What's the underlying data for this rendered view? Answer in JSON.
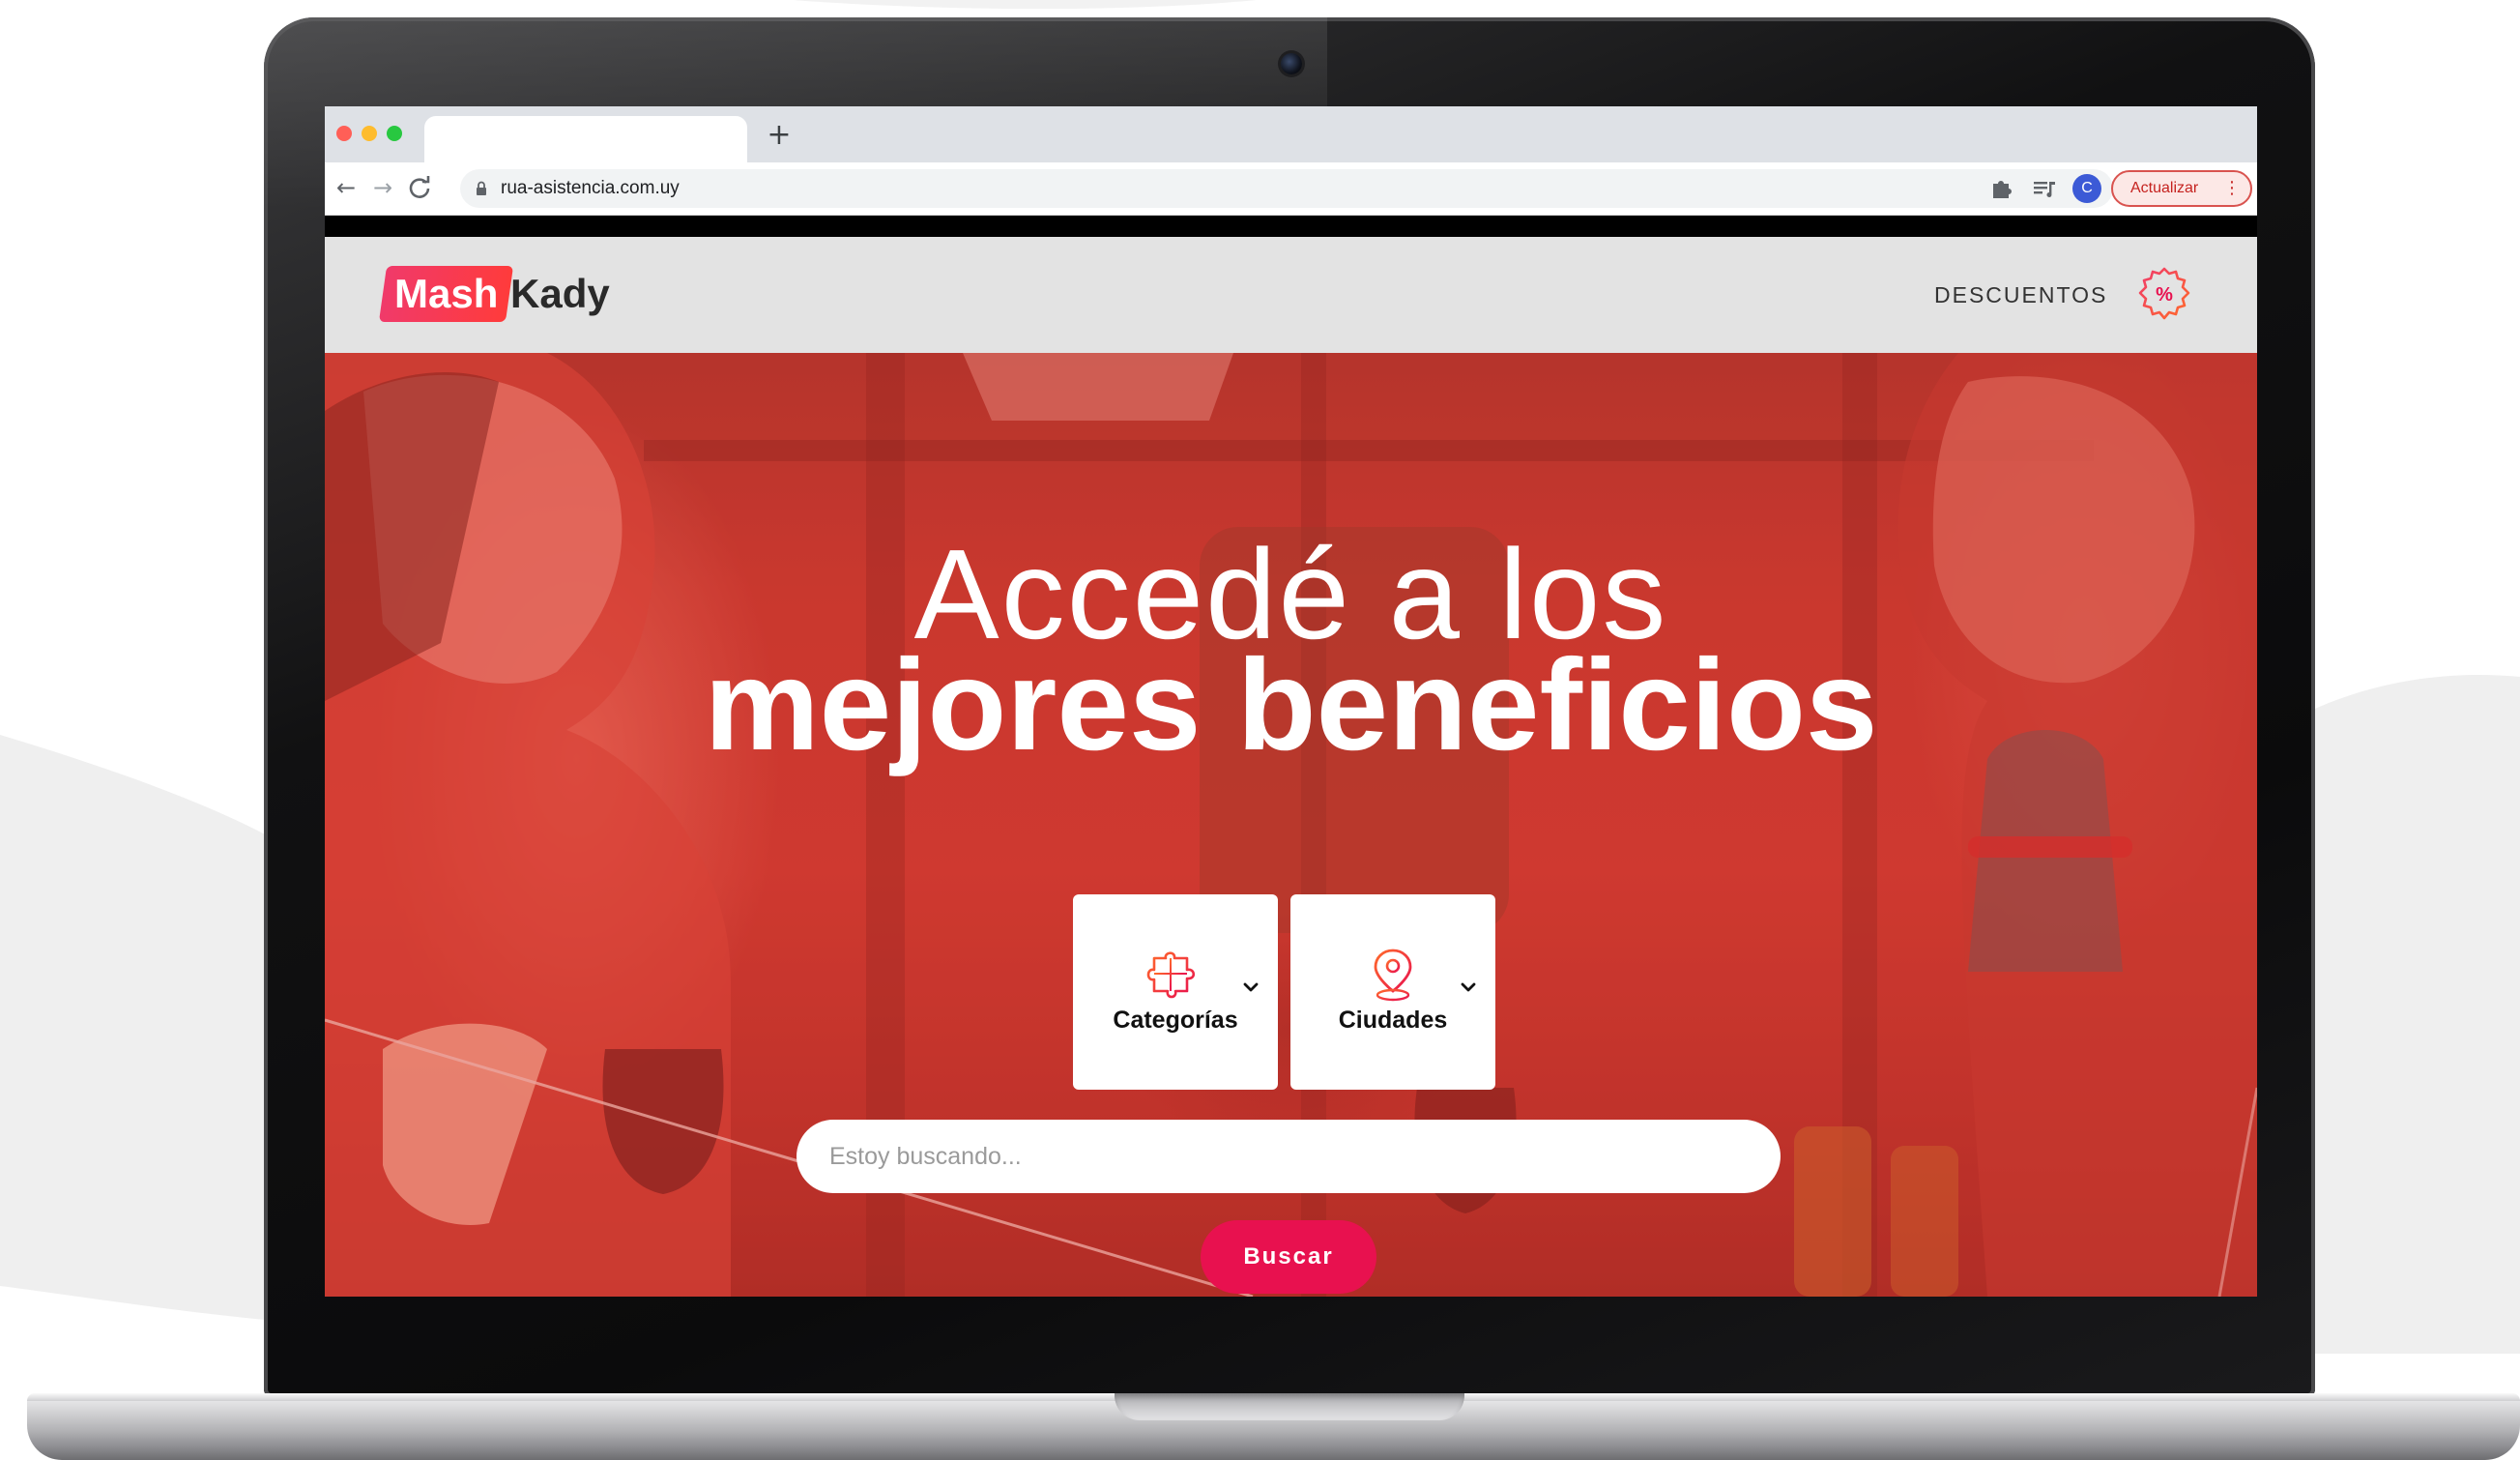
{
  "browser": {
    "url": "rua-asistencia.com.uy",
    "new_tab_icon": "+",
    "back_icon": "←",
    "forward_icon": "→",
    "reload_icon": "C",
    "bookmark_icon": "☆",
    "profile_initial": "C",
    "update_label": "Actualizar",
    "menu_icon": "⋮"
  },
  "site": {
    "logo_part1": "Mash",
    "logo_part2": "Kady",
    "nav_descuentos": "DESCUENTOS",
    "discount_symbol": "%"
  },
  "hero": {
    "title_line1": "Accedé a los",
    "title_line2": "mejores beneficios"
  },
  "filters": {
    "categories_label": "Categorías",
    "cities_label": "Ciudades"
  },
  "search": {
    "placeholder": "Estoy buscando...",
    "button_label": "Buscar"
  },
  "colors": {
    "brand_primary": "#e8114f",
    "hero_overlay": "#c4392f",
    "header_bg": "#e3e3e3",
    "logo_gradient_start": "#f03a6a",
    "logo_gradient_end": "#ff3b3b"
  }
}
